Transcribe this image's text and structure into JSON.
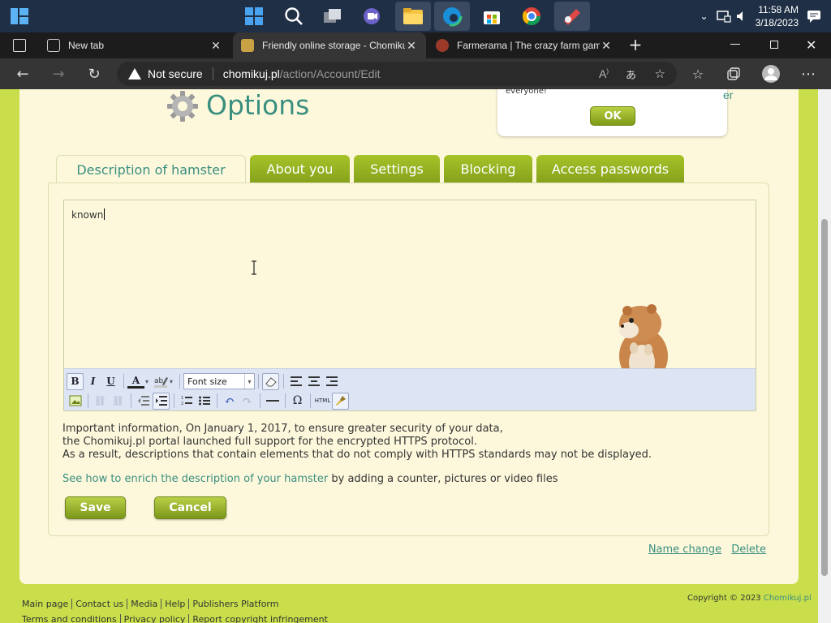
{
  "taskbar": {
    "clock_time": "11:58 AM",
    "clock_date": "3/18/2023"
  },
  "browser": {
    "tabs": [
      {
        "title": "New tab"
      },
      {
        "title": "Friendly online storage - Chomikuj"
      },
      {
        "title": "Farmerama | The crazy farm game"
      }
    ],
    "security_label": "Not secure",
    "url_host": "chomikuj.pl",
    "url_path": "/action/Account/Edit"
  },
  "page": {
    "title": "Options",
    "popup": {
      "text": "Use the file finder - it is now available for free to everyone!",
      "ok_label": "OK",
      "partial_link": "er"
    },
    "tabs": [
      {
        "label": "Description of hamster"
      },
      {
        "label": "About you"
      },
      {
        "label": "Settings"
      },
      {
        "label": "Blocking"
      },
      {
        "label": "Access passwords"
      }
    ],
    "editor": {
      "content": "known",
      "font_size_placeholder": "Font size",
      "bold": "B",
      "italic": "I",
      "underline": "U",
      "font_color": "A",
      "special_char": "Ω",
      "html": "HTML"
    },
    "info_lines": [
      "Important information, On January 1, 2017, to ensure greater security of your data,",
      "the Chomikuj.pl portal launched full support for the encrypted HTTPS protocol.",
      "As a result, descriptions that contain elements that do not comply with HTTPS standards may not be displayed."
    ],
    "enrich_link": "See how to enrich the description of your hamster",
    "enrich_rest": " by adding a counter, pictures or video files",
    "save_label": "Save",
    "cancel_label": "Cancel",
    "name_change": "Name change",
    "delete": "Delete"
  },
  "footer": {
    "links_row1": [
      "Main page",
      "Contact us",
      "Media",
      "Help",
      "Publishers Platform"
    ],
    "links_row2": [
      "Terms and conditions",
      "Privacy policy",
      "Report copyright infringement"
    ],
    "copyright": "Copyright © 2023 ",
    "brand": "Chomikuj.pl"
  },
  "colors": {
    "accent_teal": "#3a8f80",
    "lime": "#c9de4a",
    "button_green": "#8aa51d",
    "page_cream": "#fdf8dc"
  }
}
